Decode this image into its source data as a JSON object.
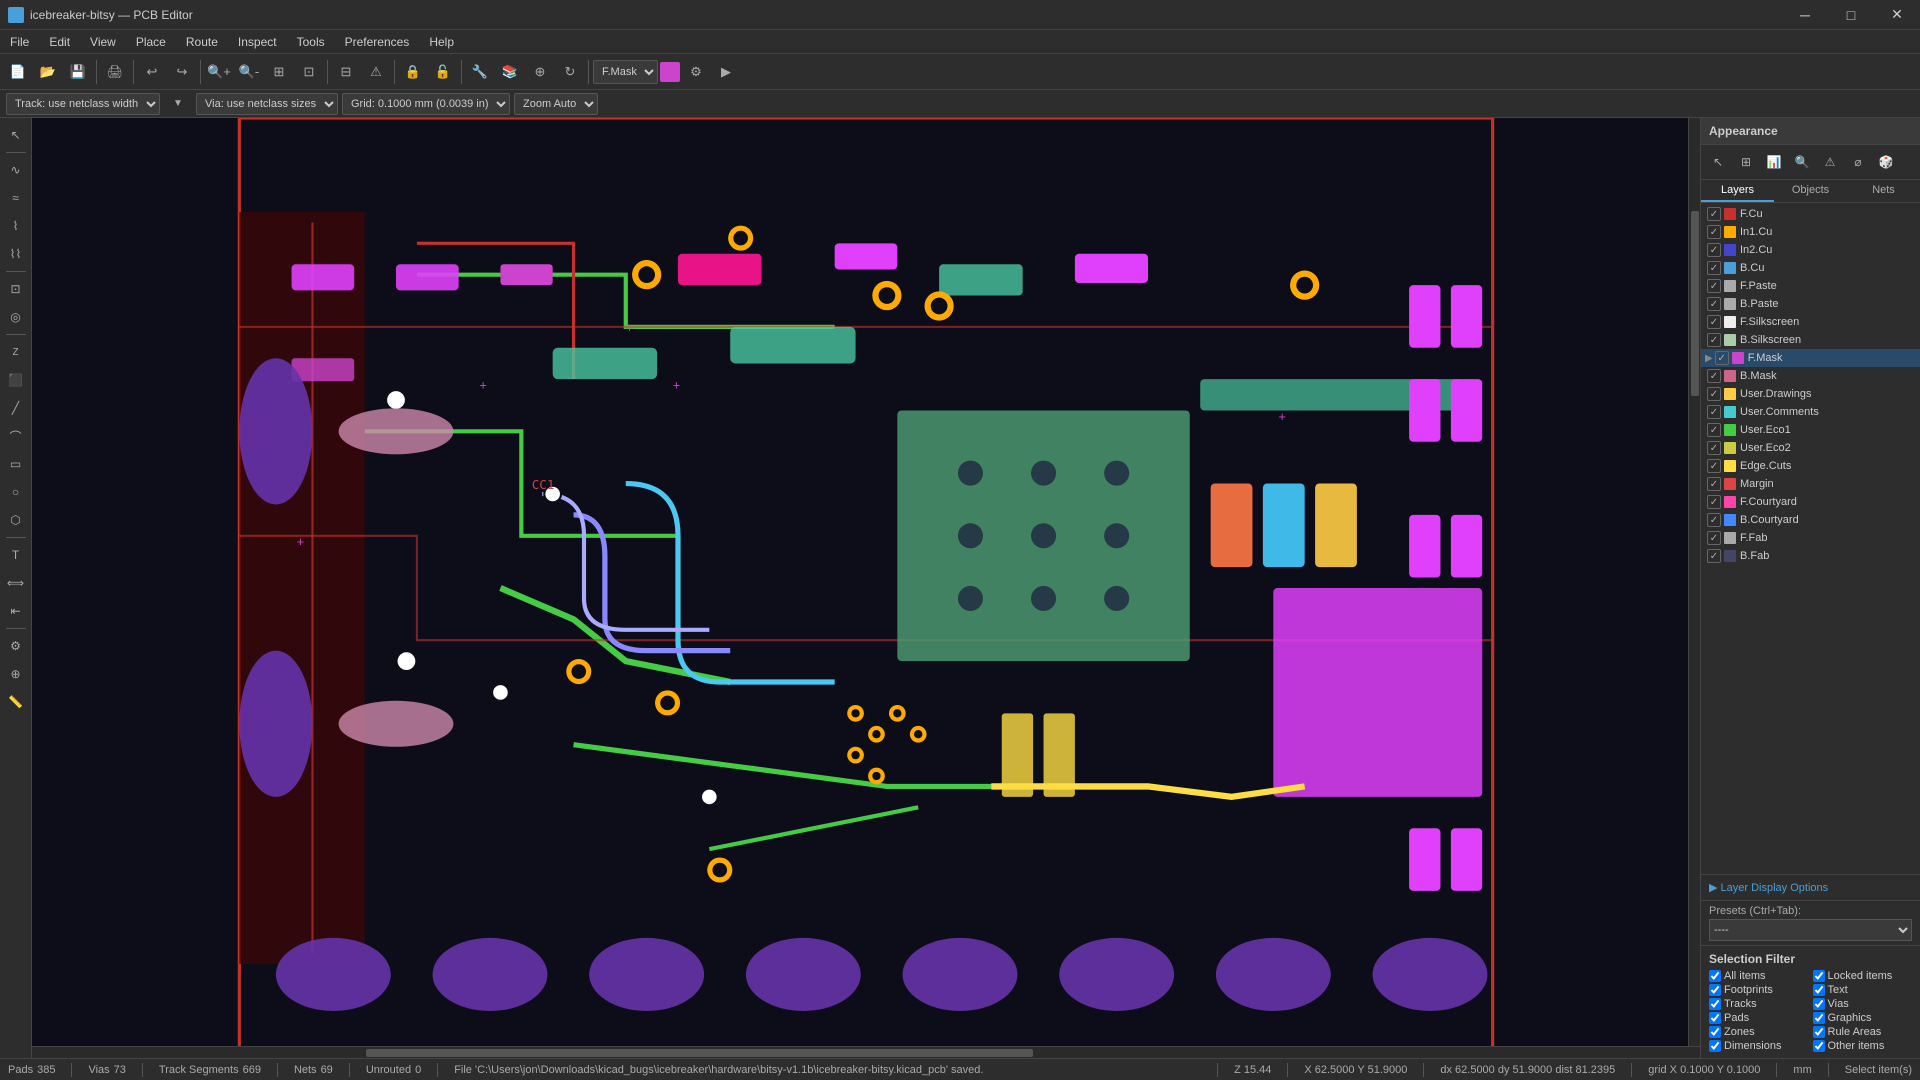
{
  "app": {
    "title": "icebreaker-bitsy — PCB Editor",
    "icon": "pcb-icon"
  },
  "titlebar": {
    "minimize": "─",
    "maximize": "□",
    "close": "✕"
  },
  "menu": {
    "items": [
      "File",
      "Edit",
      "View",
      "Place",
      "Route",
      "Inspect",
      "Tools",
      "Preferences",
      "Help"
    ]
  },
  "optbar": {
    "track": "Track: use netclass width",
    "via": "Via: use netclass sizes",
    "grid": "Grid: 0.1000 mm (0.0039 in)",
    "zoom": "Zoom Auto",
    "layer": "F.Mask"
  },
  "appearance": {
    "header": "Appearance",
    "tabs": [
      "Layers",
      "Objects",
      "Nets"
    ]
  },
  "layers": [
    {
      "name": "F.Cu",
      "color": "#c8302c",
      "visible": true,
      "active": false
    },
    {
      "name": "In1.Cu",
      "color": "#ffaa00",
      "visible": true,
      "active": false
    },
    {
      "name": "In2.Cu",
      "color": "#4444cc",
      "visible": true,
      "active": false
    },
    {
      "name": "B.Cu",
      "color": "#4a9eda",
      "visible": true,
      "active": false
    },
    {
      "name": "F.Paste",
      "color": "#aaaaaa",
      "visible": true,
      "active": false
    },
    {
      "name": "B.Paste",
      "color": "#aaaaaa",
      "visible": true,
      "active": false
    },
    {
      "name": "F.Silkscreen",
      "color": "#eeeeee",
      "visible": true,
      "active": false
    },
    {
      "name": "B.Silkscreen",
      "color": "#aaccaa",
      "visible": true,
      "active": false
    },
    {
      "name": "F.Mask",
      "color": "#cc44cc",
      "visible": true,
      "active": true
    },
    {
      "name": "B.Mask",
      "color": "#cc6688",
      "visible": true,
      "active": false
    },
    {
      "name": "User.Drawings",
      "color": "#ffcc44",
      "visible": true,
      "active": false
    },
    {
      "name": "User.Comments",
      "color": "#44cccc",
      "visible": true,
      "active": false
    },
    {
      "name": "User.Eco1",
      "color": "#44cc44",
      "visible": true,
      "active": false
    },
    {
      "name": "User.Eco2",
      "color": "#cccc44",
      "visible": true,
      "active": false
    },
    {
      "name": "Edge.Cuts",
      "color": "#ffdd44",
      "visible": true,
      "active": false
    },
    {
      "name": "Margin",
      "color": "#dd4444",
      "visible": true,
      "active": false
    },
    {
      "name": "F.Courtyard",
      "color": "#ff44aa",
      "visible": true,
      "active": false
    },
    {
      "name": "B.Courtyard",
      "color": "#4488ff",
      "visible": true,
      "active": false
    },
    {
      "name": "F.Fab",
      "color": "#aaaaaa",
      "visible": true,
      "active": false
    },
    {
      "name": "B.Fab",
      "color": "#444466",
      "visible": true,
      "active": false
    }
  ],
  "layer_display": {
    "label": "▶ Layer Display Options"
  },
  "presets": {
    "label": "Presets (Ctrl+Tab):",
    "value": "----"
  },
  "selection_filter": {
    "header": "Selection Filter",
    "items": [
      {
        "label": "All items",
        "checked": true
      },
      {
        "label": "Locked items",
        "checked": true
      },
      {
        "label": "Footprints",
        "checked": true
      },
      {
        "label": "Text",
        "checked": true
      },
      {
        "label": "Tracks",
        "checked": true
      },
      {
        "label": "Vias",
        "checked": true
      },
      {
        "label": "Pads",
        "checked": true
      },
      {
        "label": "Graphics",
        "checked": true
      },
      {
        "label": "Zones",
        "checked": true
      },
      {
        "label": "Rule Areas",
        "checked": true
      },
      {
        "label": "Dimensions",
        "checked": true
      },
      {
        "label": "Other items",
        "checked": true
      }
    ]
  },
  "statusbar": {
    "pads_label": "Pads",
    "pads_value": "385",
    "vias_label": "Vias",
    "vias_value": "73",
    "track_label": "Track Segments",
    "track_value": "669",
    "nets_label": "Nets",
    "nets_value": "69",
    "unrouted_label": "Unrouted",
    "unrouted_value": "0",
    "file": "File 'C:\\Users\\jon\\Downloads\\kicad_bugs\\icebreaker\\hardware\\bitsy-v1.1b\\icebreaker-bitsy.kicad_pcb' saved.",
    "z": "Z 15.44",
    "coords": "X 62.5000  Y 51.9000",
    "dx": "dx 62.5000  dy 51.9000  dist 81.2395",
    "grid": "grid X 0.1000  Y 0.1000",
    "unit": "mm",
    "action": "Select item(s)"
  }
}
